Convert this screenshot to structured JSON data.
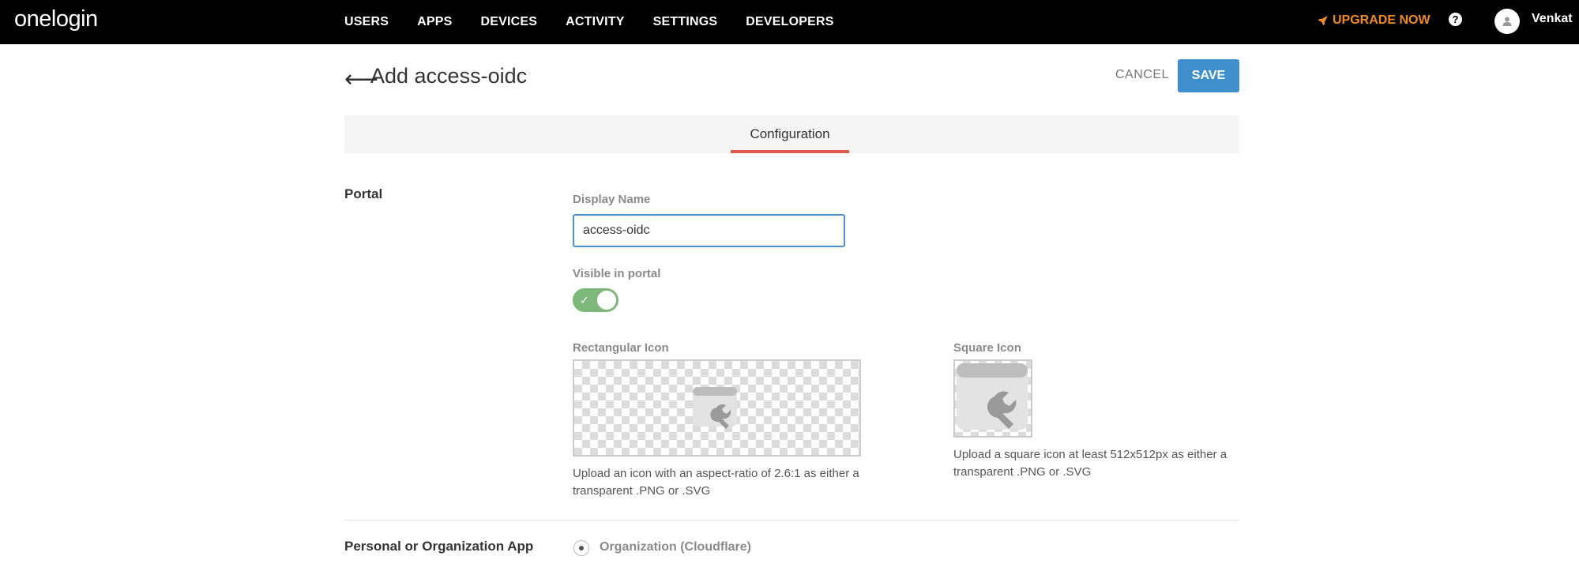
{
  "topnav": {
    "logo": "onelogin",
    "items": [
      "USERS",
      "APPS",
      "DEVICES",
      "ACTIVITY",
      "SETTINGS",
      "DEVELOPERS"
    ],
    "upgrade_label": "UPGRADE NOW",
    "upgrade_icon": "rocket-icon",
    "help_icon": "question-circle-icon",
    "help_glyph": "?",
    "avatar_icon": "user-icon",
    "username": "Venkat",
    "accent_color": "#f08a24"
  },
  "header": {
    "back_arrow": "⟵",
    "title": "Add access-oidc",
    "cancel_label": "CANCEL",
    "save_label": "SAVE",
    "save_color": "#3f8fcc"
  },
  "tabs": {
    "items": [
      {
        "label": "Configuration",
        "active": true
      }
    ],
    "active_color": "#e05a4a"
  },
  "portal": {
    "section_label": "Portal",
    "display_name_label": "Display Name",
    "display_name_value": "access-oidc",
    "visible_label": "Visible in portal",
    "visible_on": true,
    "toggle_color": "#7db77a",
    "rect_icon_label": "Rectangular Icon",
    "rect_icon_help": "Upload an icon with an aspect-ratio of 2.6:1 as either a transparent .PNG or .SVG",
    "square_icon_label": "Square Icon",
    "square_icon_help": "Upload a square icon at least 512x512px as either a transparent .PNG or .SVG",
    "placeholder_icon": "app-wrench-icon"
  },
  "app_type": {
    "section_label": "Personal or Organization App",
    "option_label": "Organization (Cloudflare)",
    "selected": true
  }
}
